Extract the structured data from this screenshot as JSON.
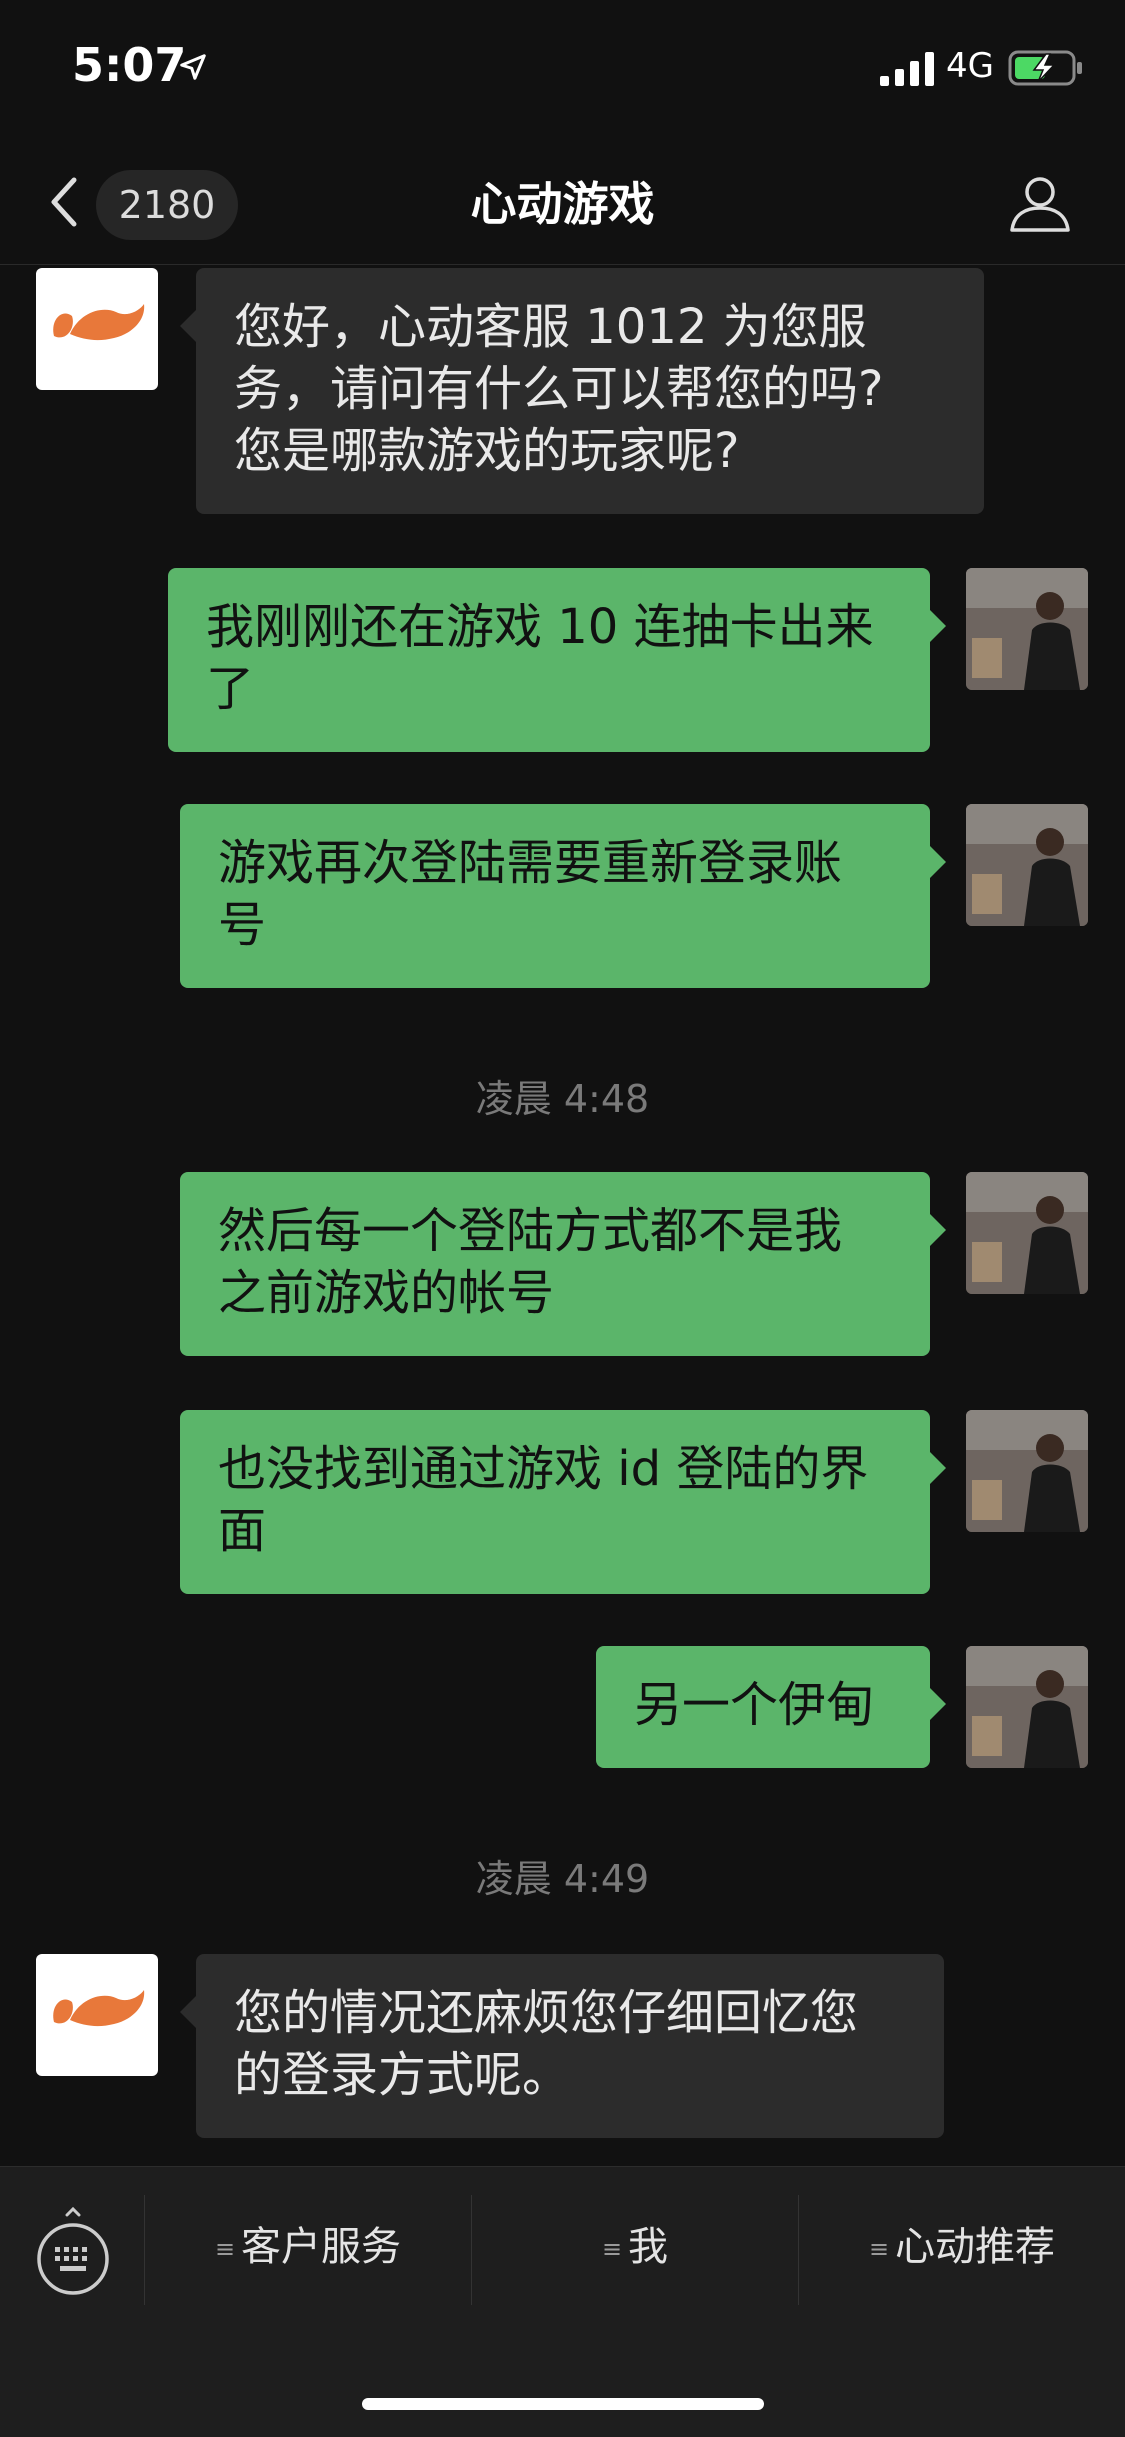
{
  "status_bar": {
    "time": "5:07",
    "carrier": "4G"
  },
  "nav": {
    "unread_count": "2180",
    "title": "心动游戏"
  },
  "messages": [
    {
      "from": "bot",
      "text_lines": [
        "您好，心动客服 1012 为您服",
        "务，请问有什么可以帮您的吗?",
        "您是哪款游戏的玩家呢?"
      ]
    },
    {
      "from": "user",
      "text_lines": [
        "我刚刚还在游戏 10 连抽卡出来",
        "了"
      ]
    },
    {
      "from": "user",
      "text_lines": [
        "游戏再次登陆需要重新登录账",
        "号"
      ]
    },
    {
      "timestamp": "凌晨 4:48"
    },
    {
      "from": "user",
      "text_lines": [
        "然后每一个登陆方式都不是我",
        "之前游戏的帐号"
      ]
    },
    {
      "from": "user",
      "text_lines": [
        "也没找到通过游戏 id 登陆的界",
        "面"
      ]
    },
    {
      "from": "user",
      "text_lines": [
        "另一个伊甸"
      ]
    },
    {
      "timestamp": "凌晨 4:49"
    },
    {
      "from": "bot",
      "text_lines": [
        "您的情况还麻烦您仔细回忆您",
        "的登录方式呢。"
      ]
    }
  ],
  "bottom_menu": [
    {
      "label": "客户服务"
    },
    {
      "label": "我"
    },
    {
      "label": "心动推荐"
    }
  ],
  "colors": {
    "user_bubble": "#5bb56a",
    "bot_bubble": "#2c2c2c",
    "brand_logo": "#e8783a",
    "background": "#111111"
  },
  "icons": [
    "back-icon",
    "profile-icon",
    "keyboard-icon",
    "location-arrow-icon",
    "signal-icon",
    "battery-charging-icon",
    "brand-logo-icon",
    "user-photo-avatar"
  ]
}
